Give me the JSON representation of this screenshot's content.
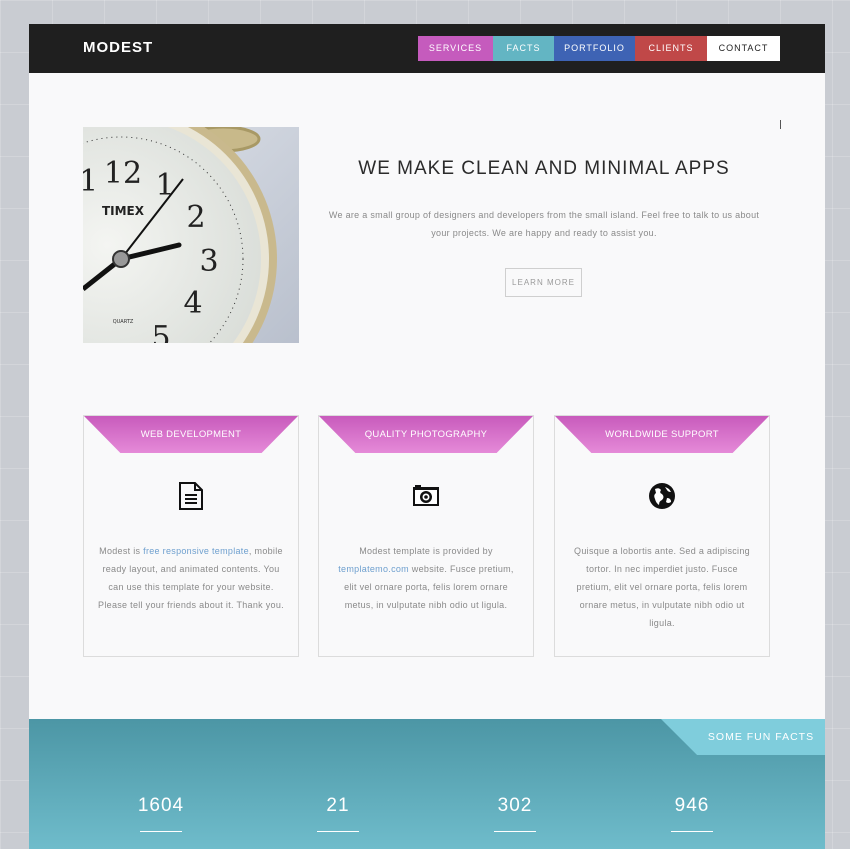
{
  "header": {
    "logo": "MODEST",
    "nav": [
      {
        "label": "SERVICES",
        "color": "#c55bbd"
      },
      {
        "label": "FACTS",
        "color": "#63b5c3"
      },
      {
        "label": "PORTFOLIO",
        "color": "#3e63b4"
      },
      {
        "label": "CLIENTS",
        "color": "#c04848"
      },
      {
        "label": "CONTACT",
        "color": "#ffffff"
      }
    ]
  },
  "hero": {
    "image_brand": "TIMEX",
    "image_subtext": "QUARTZ",
    "dial_numbers": [
      "12",
      "1",
      "2",
      "3",
      "4",
      "5",
      "11"
    ],
    "title": "WE MAKE CLEAN AND MINIMAL APPS",
    "text": "We are a small group of designers and developers from the small island. Feel free to talk to us about your projects. We are happy and ready to assist you.",
    "button": "LEARN MORE"
  },
  "services": [
    {
      "title": "WEB DEVELOPMENT",
      "icon": "document-icon",
      "text_before": "Modest is ",
      "link": "free responsive template",
      "text_after": ", mobile ready layout, and animated contents. You can use this template for your website. Please tell your friends about it. Thank you."
    },
    {
      "title": "QUALITY PHOTOGRAPHY",
      "icon": "camera-icon",
      "text_before": "Modest template is provided by ",
      "link": "templatemo.com",
      "text_after": " website. Fusce pretium, elit vel ornare porta, felis lorem ornare metus, in vulputate nibh odio ut ligula."
    },
    {
      "title": "WORLDWIDE SUPPORT",
      "icon": "globe-icon",
      "text_before": "Quisque a lobortis ante. Sed a adipiscing tortor. In nec imperdiet justo. Fusce pretium, elit vel ornare porta, felis lorem ornare metus, in vulputate nibh odio ut ligula.",
      "link": "",
      "text_after": ""
    }
  ],
  "facts": {
    "tab": "SOME FUN FACTS",
    "numbers": [
      "1604",
      "21",
      "302",
      "946"
    ]
  }
}
